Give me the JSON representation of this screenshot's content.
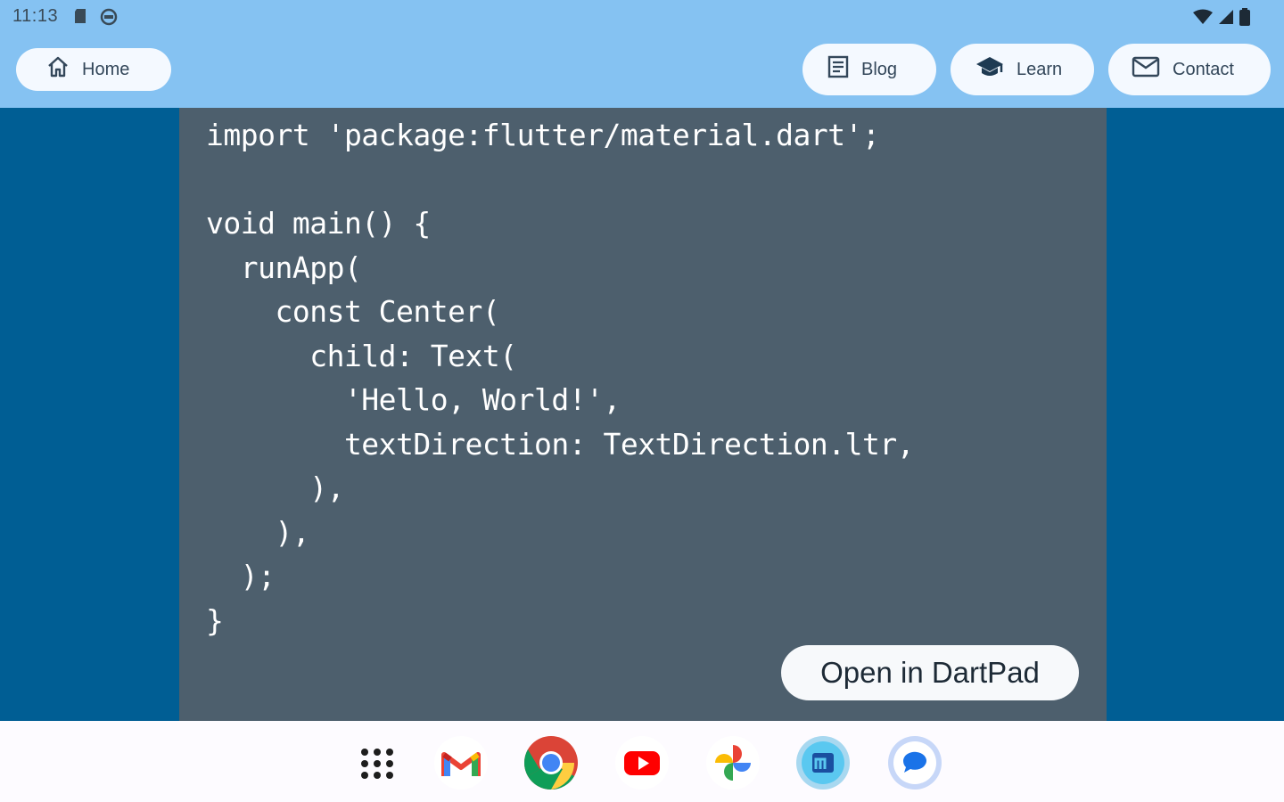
{
  "status_bar": {
    "time": "11:13",
    "left_icons": [
      "sd-card-icon",
      "vpn-icon"
    ],
    "right_icons": [
      "wifi-icon",
      "cell-signal-icon",
      "battery-icon"
    ]
  },
  "nav": {
    "home": {
      "label": "Home",
      "icon": "home-icon"
    },
    "blog": {
      "label": "Blog",
      "icon": "article-icon"
    },
    "learn": {
      "label": "Learn",
      "icon": "school-icon"
    },
    "contact": {
      "label": "Contact",
      "icon": "mail-icon"
    }
  },
  "code": {
    "lines": [
      "import 'package:flutter/material.dart';",
      "",
      "void main() {",
      "  runApp(",
      "    const Center(",
      "      child: Text(",
      "        'Hello, World!',",
      "        textDirection: TextDirection.ltr,",
      "      ),",
      "    ),",
      "  );",
      "}"
    ],
    "open_button_label": "Open in DartPad"
  },
  "dock": {
    "apps": [
      "app-drawer-icon",
      "gmail-icon",
      "chrome-icon",
      "youtube-icon",
      "photos-icon",
      "flutter-app-icon",
      "messages-icon"
    ]
  },
  "colors": {
    "app_bar": "#85c2f2",
    "background": "#005e94",
    "code_panel": "#4d5f6d",
    "button_bg": "#f4f9ff"
  }
}
